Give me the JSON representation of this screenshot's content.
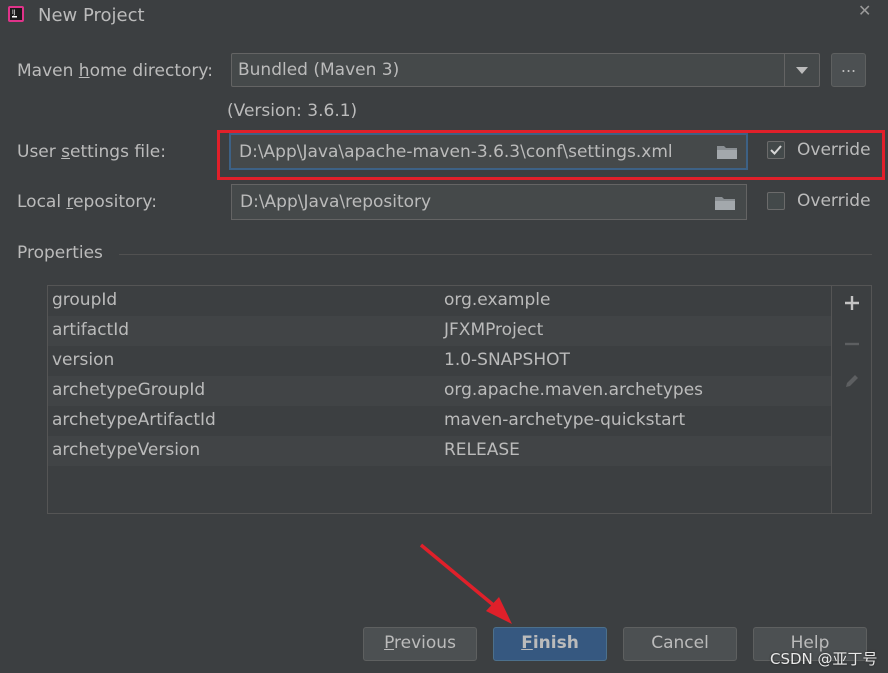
{
  "window": {
    "title": "New Project"
  },
  "maven_home": {
    "label_pre": "Maven ",
    "label_u": "h",
    "label_post": "ome directory:",
    "value": "Bundled (Maven 3)",
    "browse_label": "...",
    "version": "(Version: 3.6.1)"
  },
  "user_settings": {
    "label_pre": "User ",
    "label_u": "s",
    "label_post": "ettings file:",
    "value": "D:\\App\\Java\\apache-maven-3.6.3\\conf\\settings.xml",
    "override_label": "Override",
    "override_checked": true
  },
  "local_repo": {
    "label_pre": "Local ",
    "label_u": "r",
    "label_post": "epository:",
    "value": "D:\\App\\Java\\repository",
    "override_label": "Override",
    "override_checked": false
  },
  "properties": {
    "title": "Properties",
    "rows": [
      {
        "key": "groupId",
        "value": "org.example"
      },
      {
        "key": "artifactId",
        "value": "JFXMProject"
      },
      {
        "key": "version",
        "value": "1.0-SNAPSHOT"
      },
      {
        "key": "archetypeGroupId",
        "value": "org.apache.maven.archetypes"
      },
      {
        "key": "archetypeArtifactId",
        "value": "maven-archetype-quickstart"
      },
      {
        "key": "archetypeVersion",
        "value": "RELEASE"
      }
    ]
  },
  "buttons": {
    "previous_u": "P",
    "previous_rest": "revious",
    "finish_u": "F",
    "finish_rest": "inish",
    "cancel": "Cancel",
    "help": "Help"
  },
  "watermark": "CSDN @亚丁号",
  "colors": {
    "accent": "#365880",
    "annotation": "#e0202a",
    "background": "#3c3f41"
  }
}
